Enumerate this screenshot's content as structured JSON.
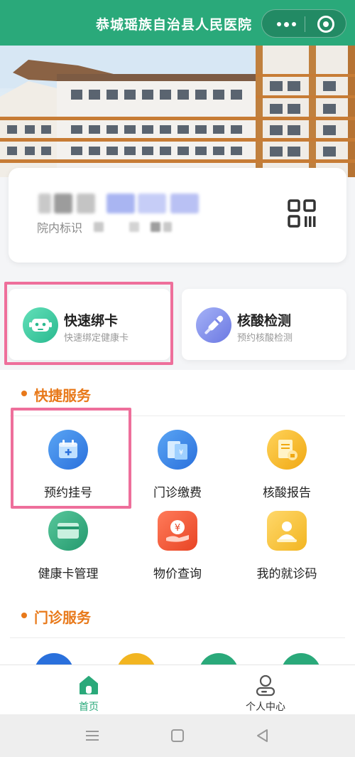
{
  "header": {
    "title": "恭城瑶族自治县人民医院",
    "more_icon": "more-dots-icon",
    "close_icon": "target-circle-icon"
  },
  "card": {
    "id_label": "院内标识",
    "qr_icon": "qr-code-icon"
  },
  "quick_cards": [
    {
      "title": "快速绑卡",
      "subtitle": "快速绑定健康卡",
      "icon": "robot-icon",
      "color": "#3cc9a0"
    },
    {
      "title": "核酸检测",
      "subtitle": "预约核酸检测",
      "icon": "swab-icon",
      "color": "#7b86e6"
    }
  ],
  "sections": {
    "quick_services": {
      "title": "快捷服务",
      "items": [
        {
          "label": "预约挂号",
          "icon": "calendar-icon",
          "color": "#2f7fe0"
        },
        {
          "label": "门诊缴费",
          "icon": "payment-icon",
          "color": "#2f7fe0"
        },
        {
          "label": "核酸报告",
          "icon": "report-icon",
          "color": "#f2b521"
        },
        {
          "label": "健康卡管理",
          "icon": "card-icon",
          "color": "#2aa97a"
        },
        {
          "label": "物价查询",
          "icon": "price-icon",
          "color": "#ef5a36"
        },
        {
          "label": "我的就诊码",
          "icon": "user-code-icon",
          "color": "#f2b521"
        }
      ]
    },
    "outpatient_services": {
      "title": "门诊服务"
    }
  },
  "tabbar": {
    "home": {
      "label": "首页",
      "icon": "home-icon",
      "active": true
    },
    "profile": {
      "label": "个人中心",
      "icon": "person-icon",
      "active": false
    }
  },
  "colors": {
    "brand": "#2aa97a",
    "accent_orange": "#e8791a",
    "highlight": "#ee6f9b"
  }
}
